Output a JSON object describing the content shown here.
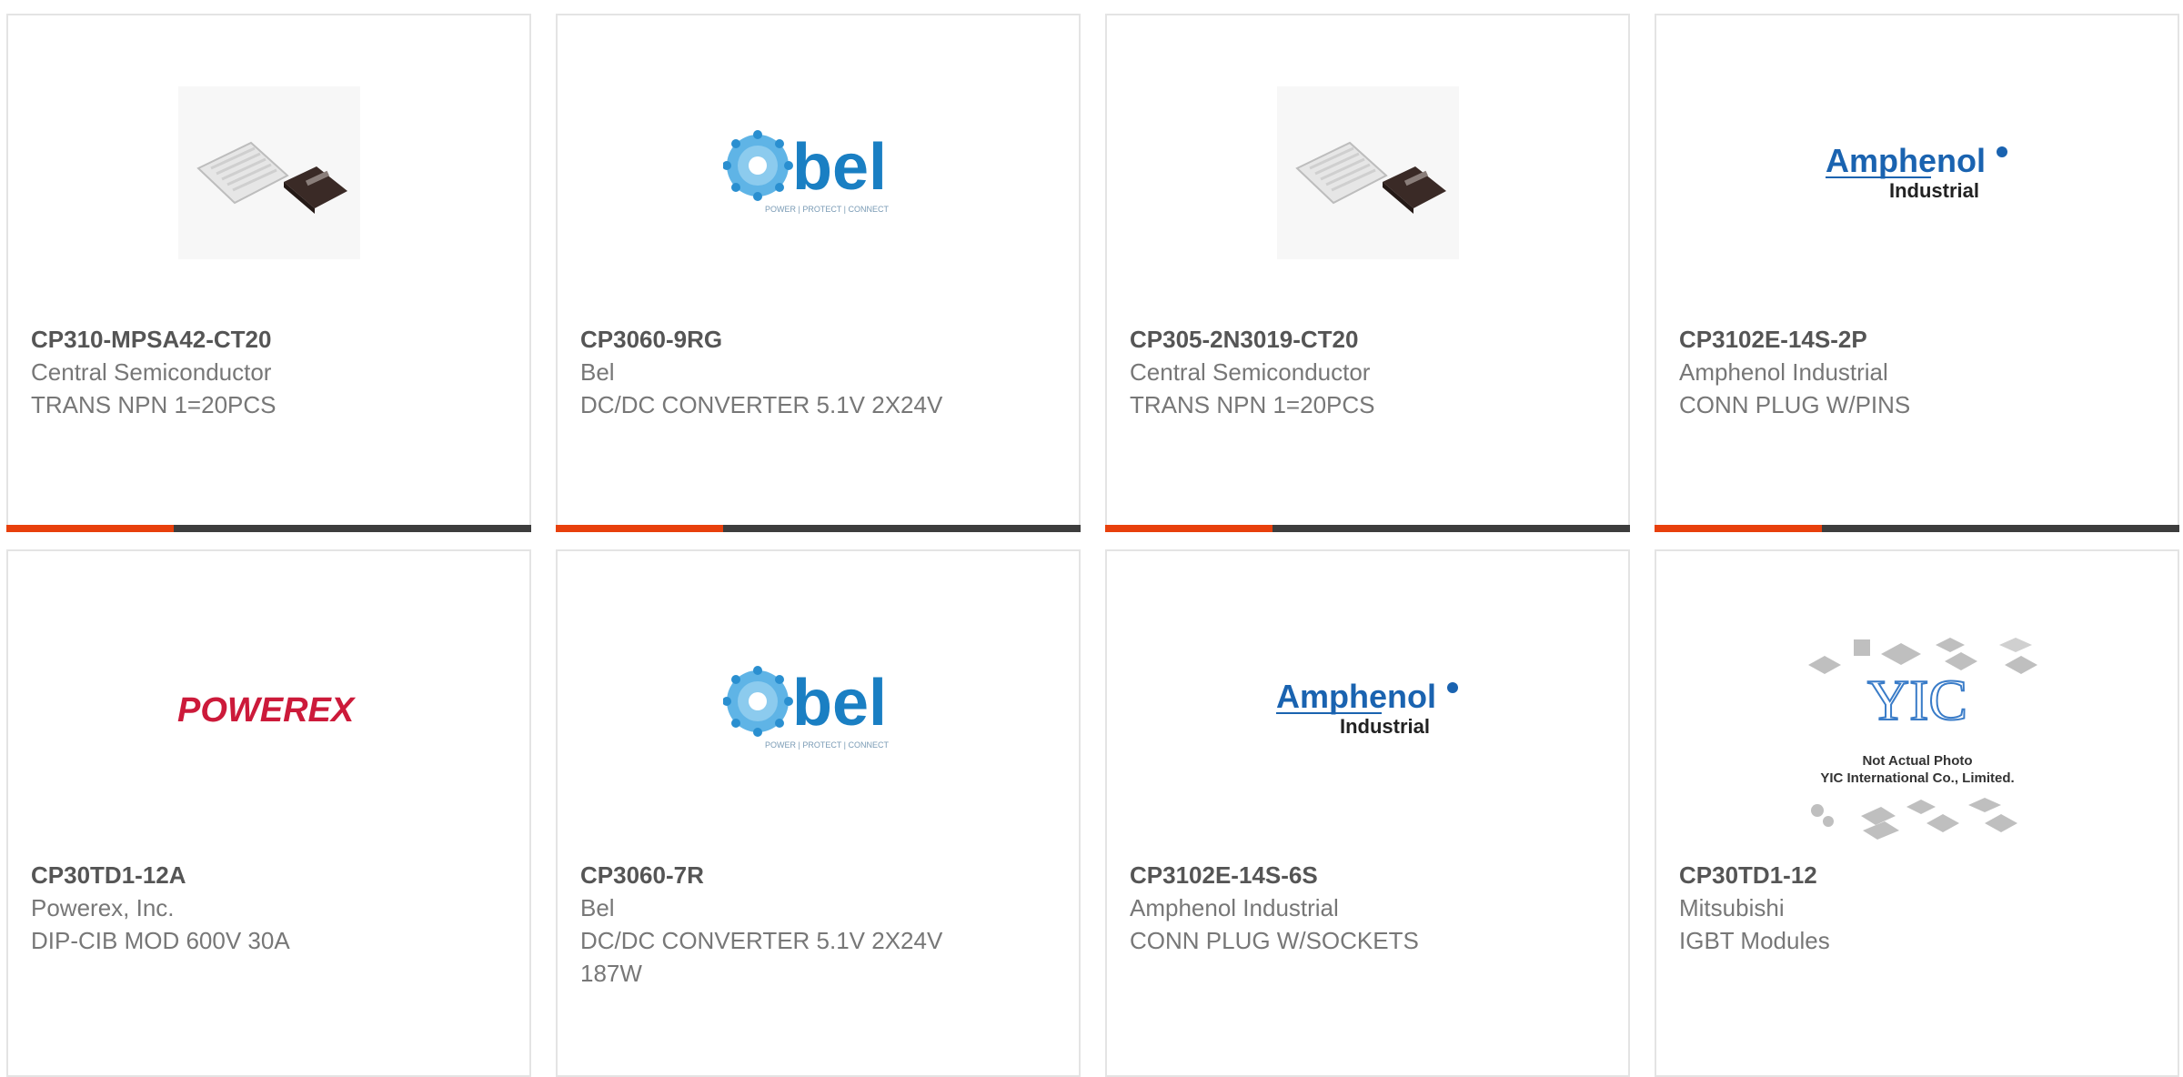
{
  "colors": {
    "accent": "#e8400c",
    "bar": "#3d3d3d",
    "bel": "#1a7fc3",
    "powerex": "#cc1a3a",
    "amphenol": "#1a63b0"
  },
  "products": [
    {
      "part": "CP310-MPSA42-CT20",
      "manufacturer": "Central Semiconductor",
      "description": "TRANS NPN 1=20PCS",
      "image": "chip-photo"
    },
    {
      "part": "CP3060-9RG",
      "manufacturer": "Bel",
      "description": "DC/DC CONVERTER 5.1V 2X24V",
      "image": "bel-logo",
      "logo_text": "bel",
      "logo_tagline": "POWER | PROTECT | CONNECT"
    },
    {
      "part": "CP305-2N3019-CT20",
      "manufacturer": "Central Semiconductor",
      "description": "TRANS NPN 1=20PCS",
      "image": "chip-photo"
    },
    {
      "part": "CP3102E-14S-2P",
      "manufacturer": "Amphenol Industrial",
      "description": "CONN PLUG W/PINS",
      "image": "amphenol-logo",
      "logo_text": "Amphenol",
      "logo_sub": "Industrial"
    },
    {
      "part": "CP30TD1-12A",
      "manufacturer": "Powerex, Inc.",
      "description": "DIP-CIB MOD 600V 30A",
      "image": "powerex-logo",
      "logo_text": "POWEREX"
    },
    {
      "part": "CP3060-7R",
      "manufacturer": "Bel",
      "description": "DC/DC CONVERTER 5.1V 2X24V 187W",
      "image": "bel-logo",
      "logo_text": "bel",
      "logo_tagline": "POWER | PROTECT | CONNECT"
    },
    {
      "part": "CP3102E-14S-6S",
      "manufacturer": "Amphenol Industrial",
      "description": "CONN PLUG W/SOCKETS",
      "image": "amphenol-logo",
      "logo_text": "Amphenol",
      "logo_sub": "Industrial"
    },
    {
      "part": "CP30TD1-12",
      "manufacturer": "Mitsubishi",
      "description": "IGBT Modules",
      "image": "yic-placeholder",
      "logo_text": "YIC",
      "logo_line1": "Not Actual Photo",
      "logo_line2": "YIC International Co., Limited."
    }
  ]
}
